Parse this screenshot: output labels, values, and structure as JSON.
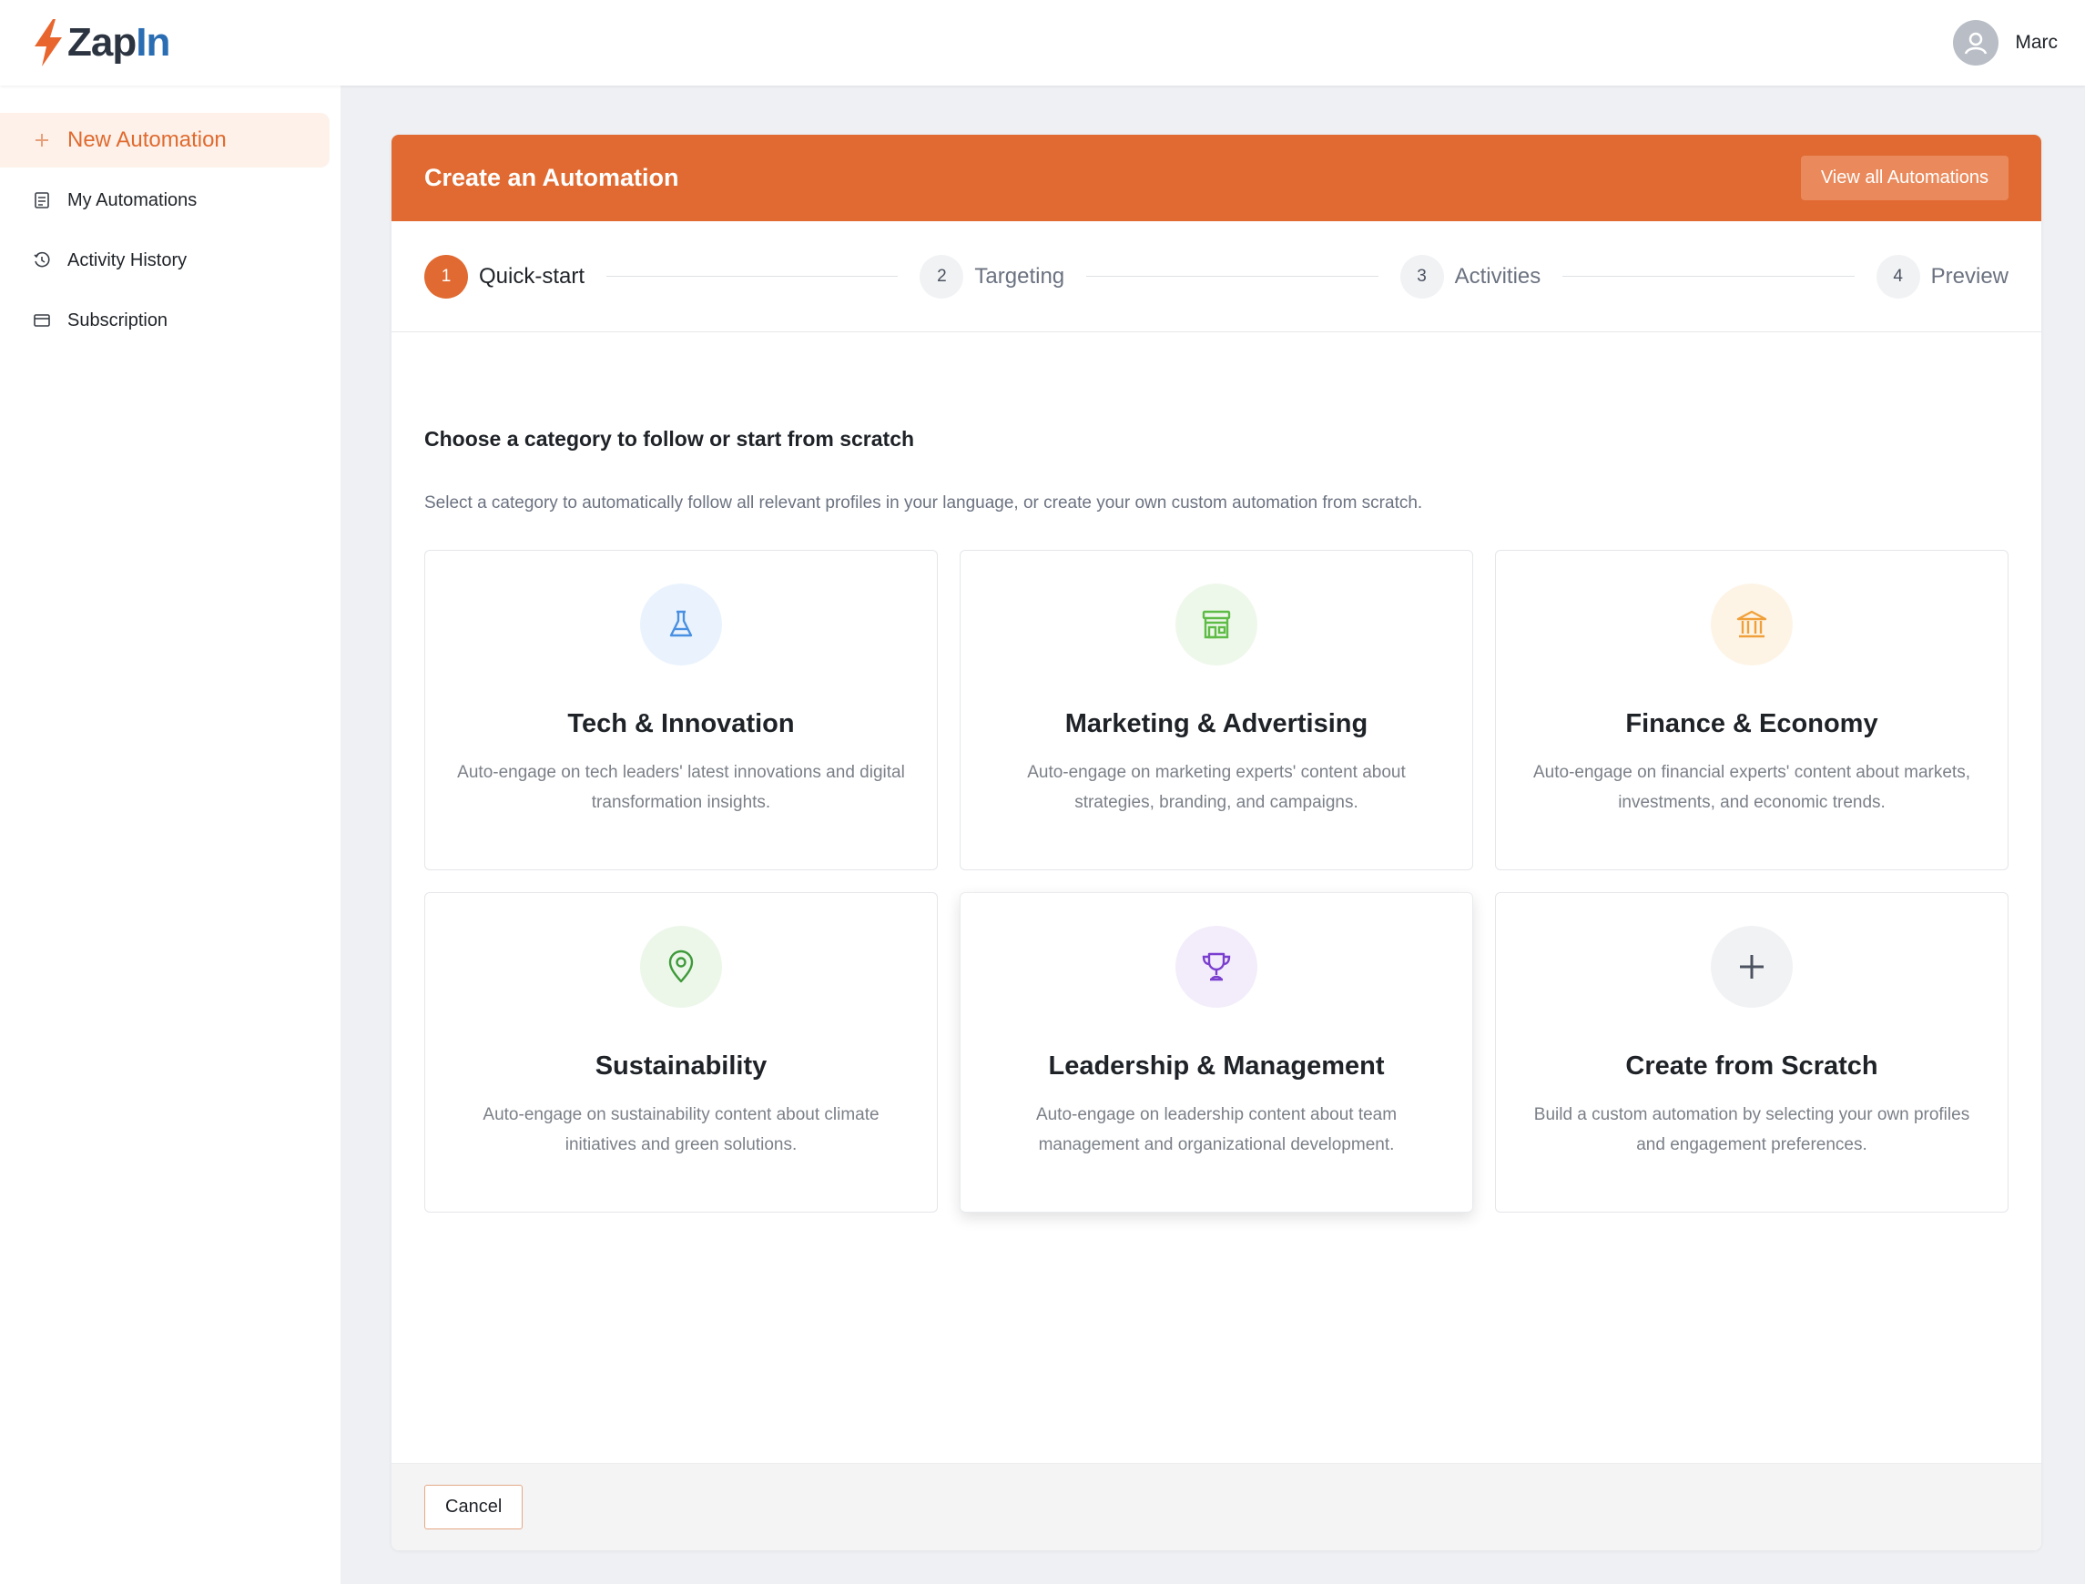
{
  "brand": {
    "name_part1": "Zap",
    "name_part2": "In",
    "accent": "#e06a31"
  },
  "user": {
    "name": "Marc",
    "icon": "user-icon"
  },
  "sidebar": {
    "items": [
      {
        "label": "New Automation",
        "icon": "plus-icon",
        "active": true
      },
      {
        "label": "My Automations",
        "icon": "clipboard-icon",
        "active": false
      },
      {
        "label": "Activity History",
        "icon": "history-icon",
        "active": false
      },
      {
        "label": "Subscription",
        "icon": "card-icon",
        "active": false
      }
    ]
  },
  "panel": {
    "title": "Create an Automation",
    "view_all_label": "View all Automations",
    "steps": [
      {
        "num": "1",
        "label": "Quick-start",
        "active": true
      },
      {
        "num": "2",
        "label": "Targeting",
        "active": false
      },
      {
        "num": "3",
        "label": "Activities",
        "active": false
      },
      {
        "num": "4",
        "label": "Preview",
        "active": false
      }
    ],
    "heading": "Choose a category to follow or start from scratch",
    "subtext": "Select a category to automatically follow all relevant profiles in your language, or create your own custom automation from scratch.",
    "cards": [
      {
        "title": "Tech & Innovation",
        "desc": "Auto-engage on tech leaders' latest innovations and digital transformation insights.",
        "icon": "flask-icon",
        "icon_color": "#4a90e2",
        "icon_bg": "#eaf3fd"
      },
      {
        "title": "Marketing & Advertising",
        "desc": "Auto-engage on marketing experts' content about strategies, branding, and campaigns.",
        "icon": "storefront-icon",
        "icon_color": "#5dbb46",
        "icon_bg": "#eef8ea"
      },
      {
        "title": "Finance & Economy",
        "desc": "Auto-engage on financial experts' content about markets, investments, and economic trends.",
        "icon": "bank-icon",
        "icon_color": "#f0a03a",
        "icon_bg": "#fdf4e6"
      },
      {
        "title": "Sustainability",
        "desc": "Auto-engage on sustainability content about climate initiatives and green solutions.",
        "icon": "location-pin-icon",
        "icon_color": "#3f9a3a",
        "icon_bg": "#ecf7ea"
      },
      {
        "title": "Leadership & Management",
        "desc": "Auto-engage on leadership content about team management and organizational development.",
        "icon": "trophy-icon",
        "icon_color": "#7b3fcf",
        "icon_bg": "#f3edfb"
      },
      {
        "title": "Create from Scratch",
        "desc": "Build a custom automation by selecting your own profiles and engagement preferences.",
        "icon": "plus-icon",
        "icon_color": "#4b5260",
        "icon_bg": "#f1f2f4"
      }
    ],
    "cancel_label": "Cancel"
  }
}
